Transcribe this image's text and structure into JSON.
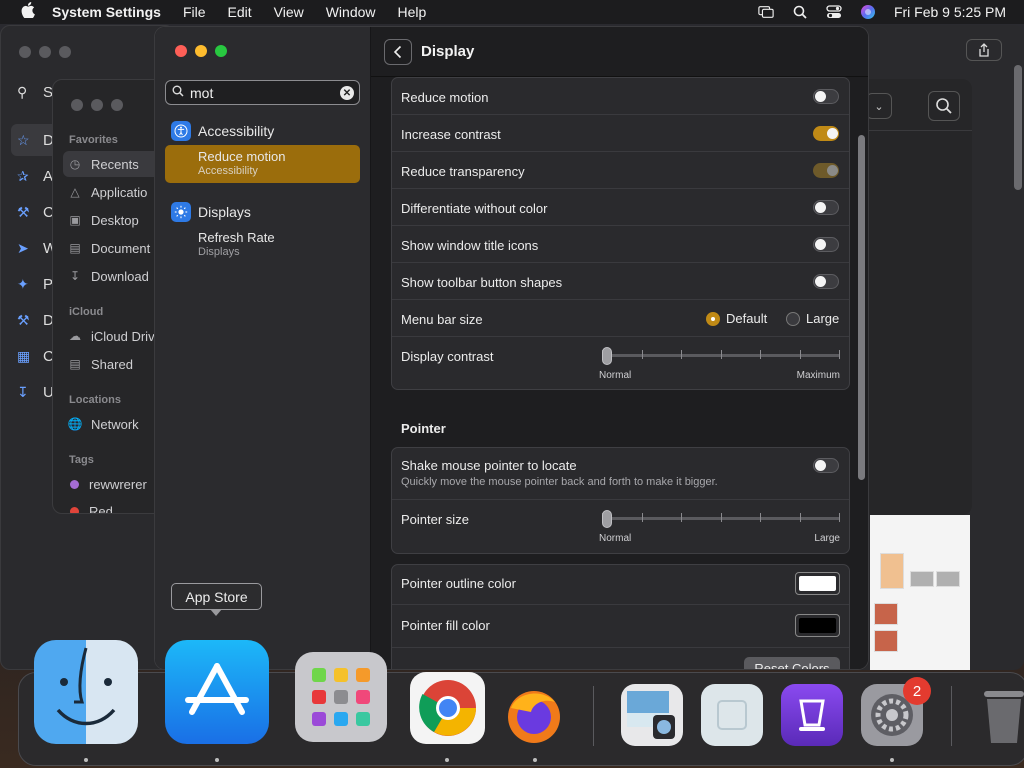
{
  "menubar": {
    "app_name": "System Settings",
    "menus": [
      "File",
      "Edit",
      "View",
      "Window",
      "Help"
    ],
    "datetime": "Fri Feb 9  5:25 PM"
  },
  "bg_window": {
    "search_letter": "S",
    "items": [
      "D",
      "A",
      "C",
      "W",
      "P",
      "D",
      "C",
      "U"
    ]
  },
  "finder": {
    "favorites_title": "Favorites",
    "favorites": [
      "Recents",
      "Applicatio",
      "Desktop",
      "Document",
      "Download"
    ],
    "icloud_title": "iCloud",
    "icloud": [
      "iCloud Driv",
      "Shared"
    ],
    "locations_title": "Locations",
    "locations": [
      "Network"
    ],
    "tags_title": "Tags",
    "tags": [
      {
        "name": "rewwrerer",
        "color": "#a46cd4"
      },
      {
        "name": "Red",
        "color": "#e0443a"
      }
    ]
  },
  "sidebar": {
    "search_value": "mot",
    "groups": [
      {
        "label": "Accessibility",
        "icon": "accessibility-icon",
        "color": "#2e7ae6",
        "results": [
          {
            "main": "Reduce motion",
            "sub": "Accessibility",
            "selected": true
          }
        ]
      },
      {
        "label": "Displays",
        "icon": "displays-icon",
        "color": "#2e7ae6",
        "results": [
          {
            "main": "Refresh Rate",
            "sub": "Displays",
            "selected": false
          }
        ]
      }
    ]
  },
  "content": {
    "title": "Display",
    "rows": [
      {
        "label": "Reduce motion",
        "state": "off"
      },
      {
        "label": "Increase contrast",
        "state": "on"
      },
      {
        "label": "Reduce transparency",
        "state": "dim"
      },
      {
        "label": "Differentiate without color",
        "state": "off"
      },
      {
        "label": "Show window title icons",
        "state": "off"
      },
      {
        "label": "Show toolbar button shapes",
        "state": "off"
      }
    ],
    "menu_bar_size": {
      "label": "Menu bar size",
      "options": [
        "Default",
        "Large"
      ],
      "selected": "Default"
    },
    "display_contrast": {
      "label": "Display contrast",
      "min_label": "Normal",
      "max_label": "Maximum",
      "value": 0
    },
    "pointer_section": "Pointer",
    "shake": {
      "label": "Shake mouse pointer to locate",
      "desc": "Quickly move the mouse pointer back and forth to make it bigger.",
      "state": "off"
    },
    "pointer_size": {
      "label": "Pointer size",
      "min_label": "Normal",
      "max_label": "Large",
      "value": 0
    },
    "outline_color": {
      "label": "Pointer outline color",
      "color": "#ffffff"
    },
    "fill_color": {
      "label": "Pointer fill color",
      "color": "#000000"
    },
    "reset_label": "Reset Colors"
  },
  "tooltip": "App Store",
  "dock": {
    "settings_badge": "2"
  },
  "colors": {
    "accent": "#c08a16",
    "selection": "#9b6d0c"
  }
}
